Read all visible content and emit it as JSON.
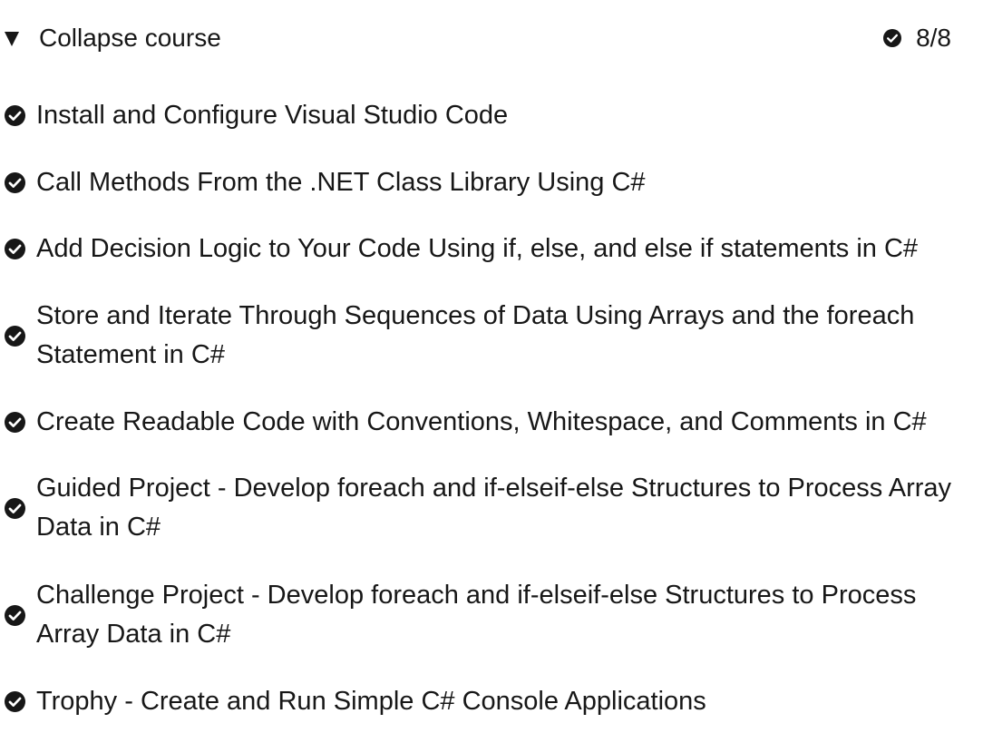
{
  "header": {
    "collapse_label": "Collapse course",
    "progress": "8/8"
  },
  "modules": [
    {
      "label": "Install and Configure Visual Studio Code",
      "completed": true
    },
    {
      "label": "Call Methods From the .NET Class Library Using C#",
      "completed": true
    },
    {
      "label": "Add Decision Logic to Your Code Using if, else, and else if statements in C#",
      "completed": true
    },
    {
      "label": "Store and Iterate Through Sequences of Data Using Arrays and the foreach Statement in C#",
      "completed": true
    },
    {
      "label": "Create Readable Code with Conventions, Whitespace, and Comments in C#",
      "completed": true
    },
    {
      "label": "Guided Project - Develop foreach and if-elseif-else Structures to Process Array Data in C#",
      "completed": true
    },
    {
      "label": "Challenge Project - Develop foreach and if-elseif-else Structures to Process Array Data in C#",
      "completed": true
    },
    {
      "label": "Trophy - Create and Run Simple C# Console Applications",
      "completed": true
    }
  ],
  "icons": {
    "check": "check-circle-icon",
    "toggle": "triangle-down-icon"
  },
  "colors": {
    "text": "#171717",
    "icon": "#171717"
  }
}
